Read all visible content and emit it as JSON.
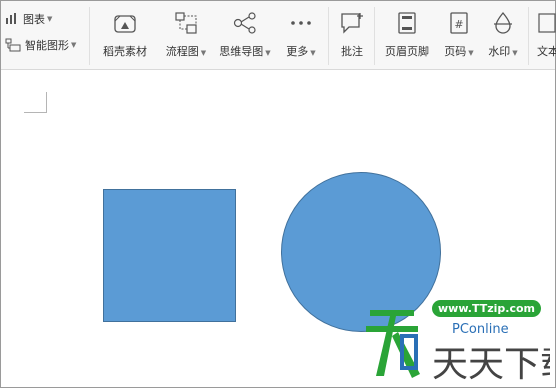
{
  "ribbon": {
    "chart_label": "图表",
    "smartart_label": "智能图形",
    "tools": [
      {
        "label": "稻壳素材",
        "has_arrow": false,
        "icon": "materials-icon"
      },
      {
        "label": "流程图",
        "has_arrow": true,
        "icon": "flowchart-icon"
      },
      {
        "label": "思维导图",
        "has_arrow": true,
        "icon": "mindmap-icon"
      },
      {
        "label": "更多",
        "has_arrow": true,
        "icon": "more-icon"
      },
      {
        "label": "批注",
        "has_arrow": false,
        "icon": "comment-icon"
      },
      {
        "label": "页眉页脚",
        "has_arrow": false,
        "icon": "header-footer-icon"
      },
      {
        "label": "页码",
        "has_arrow": true,
        "icon": "page-number-icon"
      },
      {
        "label": "水印",
        "has_arrow": true,
        "icon": "watermark-icon"
      },
      {
        "label": "文本",
        "has_arrow": false,
        "icon": "textbox-icon"
      }
    ]
  },
  "shapes": {
    "fill": "#5b9bd5",
    "stroke": "#41719c",
    "items": [
      "rectangle",
      "circle"
    ]
  },
  "watermark": {
    "url": "www.TTzip.com",
    "pconline": "PConline",
    "title": "天天下载"
  }
}
